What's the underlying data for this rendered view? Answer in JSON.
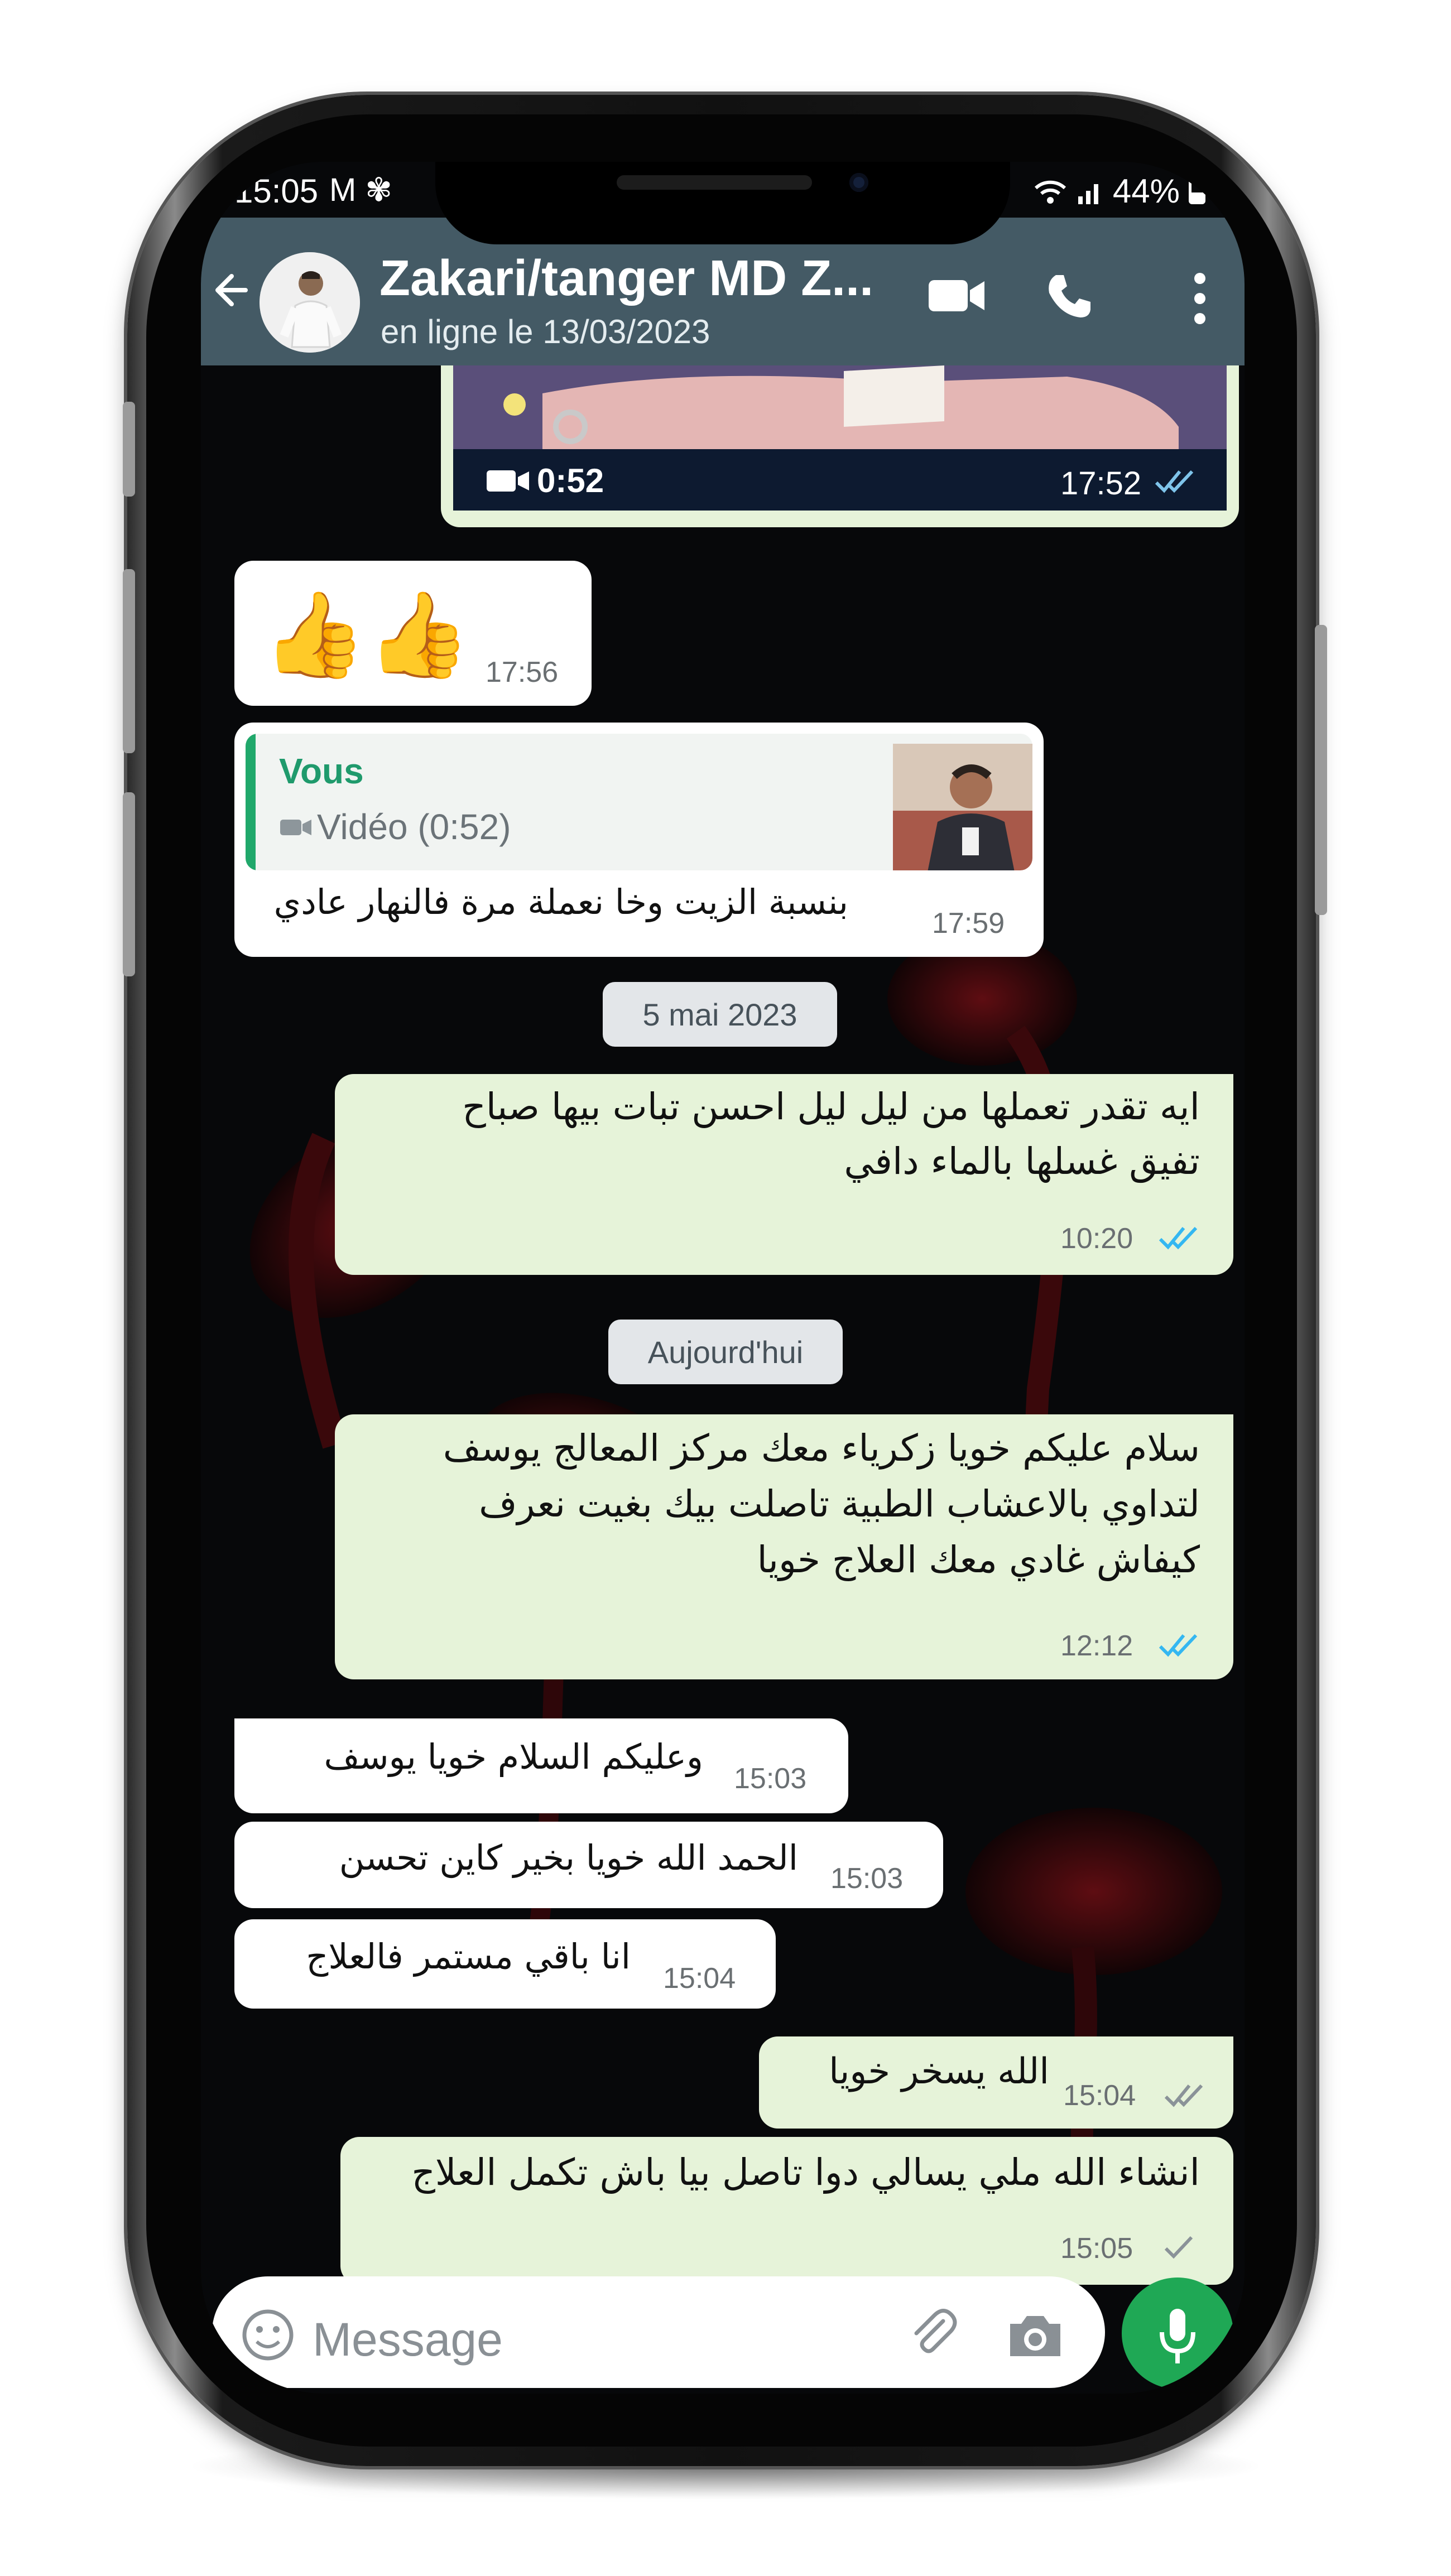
{
  "status_bar": {
    "time": "15:05",
    "left_icons": "M ✾",
    "battery_text": "44%"
  },
  "header": {
    "title": "Zakari/tanger MD Z...",
    "subtitle": "en ligne le 13/03/2023"
  },
  "video_message": {
    "duration": "0:52",
    "time": "17:52"
  },
  "messages": [
    {
      "emoji": "👍👍",
      "time": "17:56"
    },
    {
      "reply_author": "Vous",
      "reply_media": "Vidéo (0:52)",
      "text": "بنسبة الزيت وخا نعملة مرة فالنهار عادي",
      "time": "17:59"
    },
    {
      "line1": "ايه تقدر تعملها من ليل ليل احسن تبات بيها صباح",
      "line2": "تفيق غسلها بالماء دافي",
      "time": "10:20"
    },
    {
      "line1": "سلام عليكم خويا زكرياء معك مركز المعالج يوسف",
      "line2": "لتداوي بالاعشاب الطبية  تاصلت بيك بغيت نعرف",
      "line3": "كيفاش غادي معك العلاج خويا",
      "time": "12:12"
    },
    {
      "text": "وعليكم السلام خويا يوسف",
      "time": "15:03"
    },
    {
      "text": "الحمد الله خويا بخير كاين تحسن",
      "time": "15:03"
    },
    {
      "text": "انا باقي مستمر فالعلاج",
      "time": "15:04"
    },
    {
      "text": "الله يسخر خويا",
      "time": "15:04"
    },
    {
      "text": "انشاء الله ملي يسالي دوا تاصل بيا باش تكمل العلاج",
      "time": "15:05"
    }
  ],
  "dates": {
    "first": "5 mai 2023",
    "second": "Aujourd'hui"
  },
  "input": {
    "placeholder": "Message"
  },
  "colors": {
    "header": "#445a65",
    "bubble_out": "#e6f3d9",
    "bubble_in": "#ffffff",
    "read_ticks": "#34b7f1",
    "accent_green": "#1fa855"
  }
}
